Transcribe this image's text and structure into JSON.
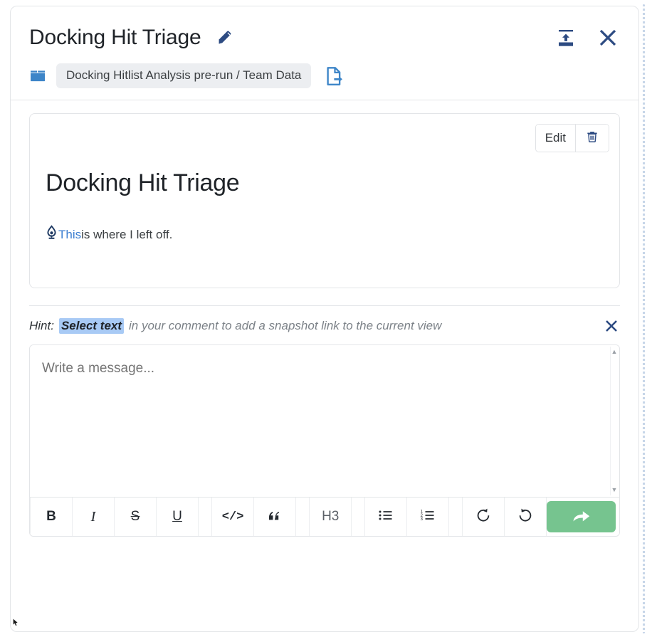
{
  "window": {
    "title": "Docking Hit Triage",
    "edit_title_icon": "pencil-icon",
    "collapse_icon": "collapse-to-top-icon",
    "close_icon": "close-icon"
  },
  "breadcrumb": {
    "folder_icon": "folder-icon",
    "path": "Docking Hitlist Analysis pre-run / Team Data",
    "open_icon": "document-export-icon"
  },
  "note": {
    "edit_label": "Edit",
    "delete_icon": "trash-icon",
    "title": "Docking Hit Triage",
    "snapshot_icon": "snapshot-droplet-icon",
    "link_text": "This",
    "body_rest": " is where I left off."
  },
  "hint": {
    "label": "Hint:",
    "highlight": "Select text",
    "rest": "in your comment to add a snapshot link to the current view",
    "close_icon": "close-icon"
  },
  "composer": {
    "placeholder": "Write a message...",
    "value": "",
    "scroll_up_icon": "caret-up-icon",
    "scroll_down_icon": "caret-down-icon",
    "toolbar": [
      {
        "name": "bold",
        "label": "B",
        "icon": "bold-icon"
      },
      {
        "name": "italic",
        "label": "I",
        "icon": "italic-icon"
      },
      {
        "name": "strikethrough",
        "label": "S",
        "icon": "strikethrough-icon"
      },
      {
        "name": "underline",
        "label": "U",
        "icon": "underline-icon"
      },
      {
        "name": "code",
        "label": "</>",
        "icon": "code-icon"
      },
      {
        "name": "blockquote",
        "label": "”",
        "icon": "quote-icon"
      },
      {
        "name": "heading-3",
        "label": "H3",
        "icon": "heading-3-icon"
      },
      {
        "name": "bullet-list",
        "label": "",
        "icon": "bullet-list-icon"
      },
      {
        "name": "ordered-list",
        "label": "",
        "icon": "ordered-list-icon"
      },
      {
        "name": "undo",
        "label": "",
        "icon": "undo-icon"
      },
      {
        "name": "redo",
        "label": "",
        "icon": "redo-icon"
      }
    ],
    "send_icon": "send-arrow-icon"
  },
  "colors": {
    "accent_blue": "#3d7fd1",
    "icon_navy": "#2d4b82",
    "send_green": "#76c48f",
    "highlight_blue": "#a8caf5",
    "border": "#e3e5e8",
    "chip_bg": "#eceef1"
  }
}
